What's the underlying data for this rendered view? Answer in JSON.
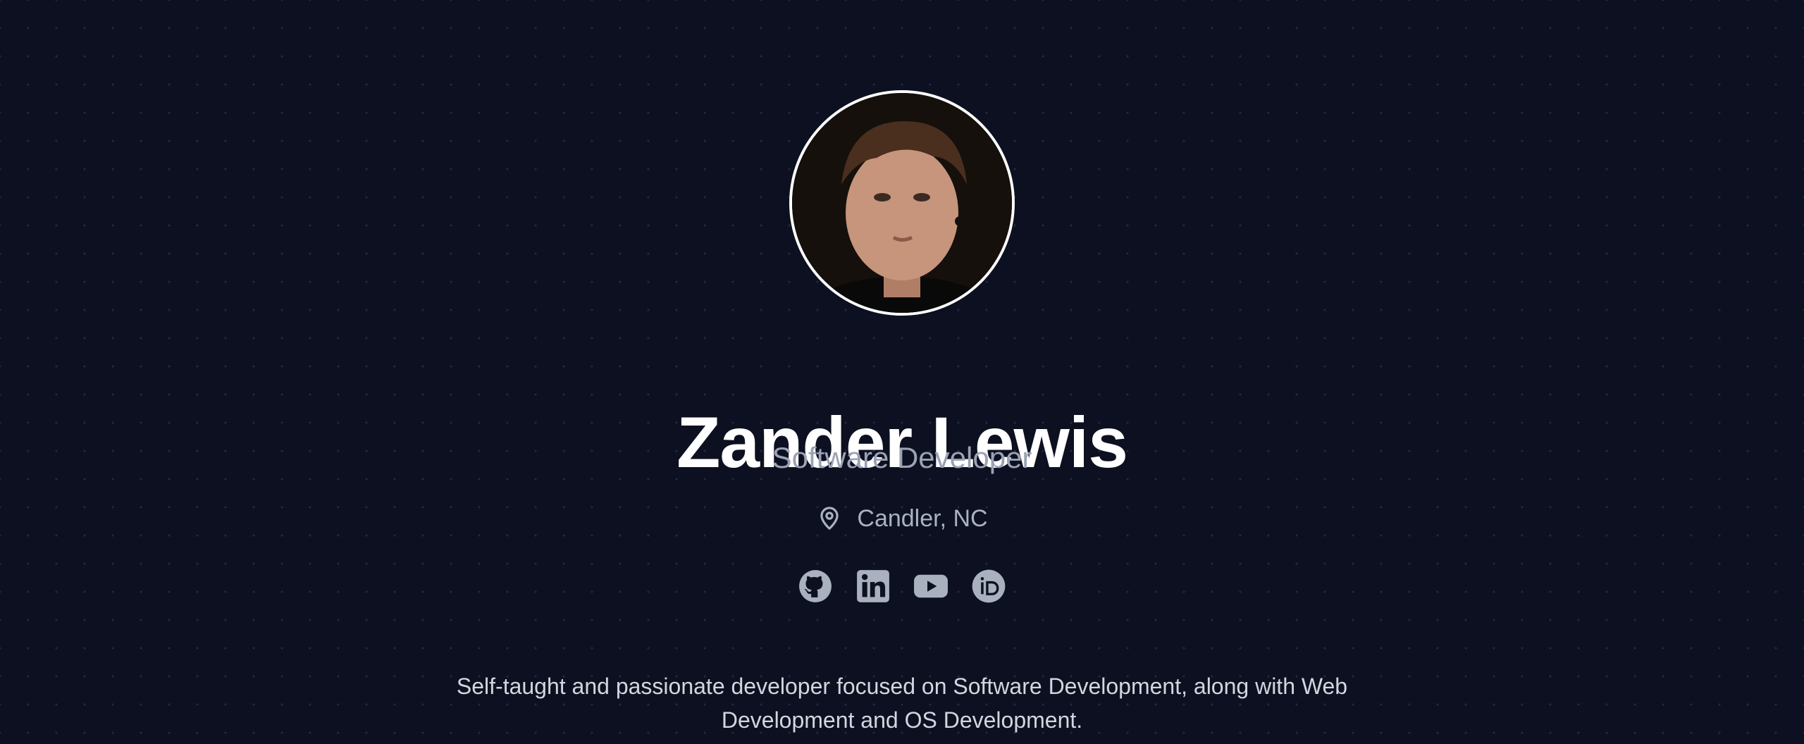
{
  "profile": {
    "name": "Zander Lewis",
    "role": "Software Developer",
    "location": "Candler, NC",
    "bio": "Self-taught and passionate developer focused on Software Development, along with Web Development and OS Development."
  },
  "socials": [
    {
      "icon": "github-icon",
      "label": "GitHub"
    },
    {
      "icon": "linkedin-icon",
      "label": "LinkedIn"
    },
    {
      "icon": "youtube-icon",
      "label": "YouTube"
    },
    {
      "icon": "orcid-icon",
      "label": "ORCID"
    }
  ],
  "colors": {
    "background": "#0c1020",
    "name": "#ffffff",
    "subtext": "#9aa2b4",
    "icon": "#a9b0be"
  }
}
